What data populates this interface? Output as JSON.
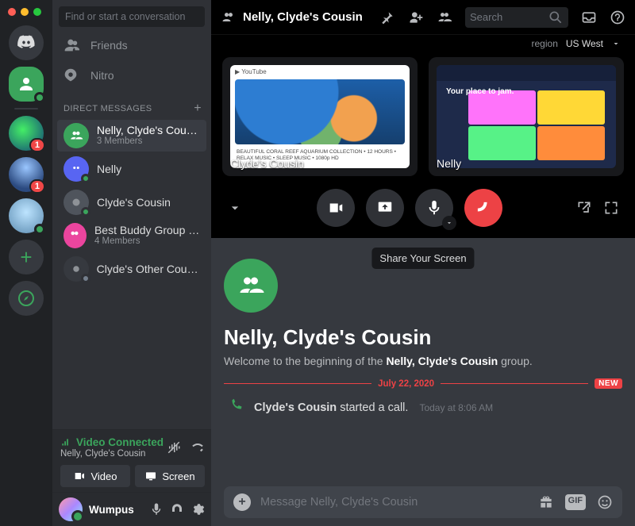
{
  "search_placeholder": "Find or start a conversation",
  "nav": {
    "friends": "Friends",
    "nitro": "Nitro"
  },
  "dm_header": "DIRECT MESSAGES",
  "dms": [
    {
      "name": "Nelly, Clyde's Cousin",
      "sub": "3 Members"
    },
    {
      "name": "Nelly"
    },
    {
      "name": "Clyde's Cousin"
    },
    {
      "name": "Best Buddy Group Ever",
      "sub": "4 Members"
    },
    {
      "name": "Clyde's Other Cousin"
    }
  ],
  "voice": {
    "status": "Video Connected",
    "channel": "Nelly, Clyde's Cousin",
    "video_btn": "Video",
    "screen_btn": "Screen"
  },
  "user": {
    "name": "Wumpus"
  },
  "topbar": {
    "title": "Nelly, Clyde's Cousin",
    "search": "Search"
  },
  "region": {
    "label": "region",
    "value": "US West"
  },
  "tiles": {
    "a": "Clyde's Cousin",
    "b": "Nelly",
    "jam": "Your place to jam."
  },
  "tooltip": "Share Your Screen",
  "chat": {
    "title": "Nelly, Clyde's Cousin",
    "welcome_pre": "Welcome to the beginning of the ",
    "welcome_bold": "Nelly, Clyde's Cousin",
    "welcome_post": " group.",
    "date": "July 22, 2020",
    "new": "NEW",
    "sys_user": "Clyde's Cousin",
    "sys_action": " started a call.",
    "sys_time": "Today at 8:06 AM",
    "input_ph": "Message Nelly, Clyde's Cousin",
    "gif": "GIF"
  },
  "badges": {
    "b1": "1",
    "b2": "1"
  }
}
